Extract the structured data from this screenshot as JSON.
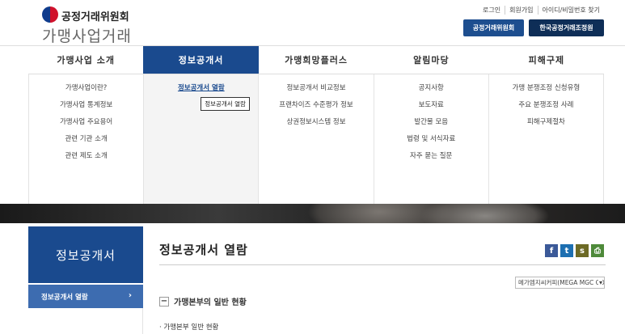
{
  "header": {
    "org_name": "공정거래위원회",
    "site_title": "가맹사업거래",
    "util_links": [
      "로그인",
      "회원가입",
      "아이디/비밀번호 찾기"
    ],
    "btn_ftc": "공정거래위원회",
    "btn_kfdm": "한국공정거래조정원"
  },
  "gnb": [
    "가맹사업 소개",
    "정보공개서",
    "가맹희망플러스",
    "알림마당",
    "피해구제"
  ],
  "mega": {
    "col0": [
      "가맹사업이란?",
      "가맹사업 통계정보",
      "가맹사업 주요용어",
      "관련 기관 소개",
      "관련 제도 소개"
    ],
    "col1": [
      "정보공개서 열람"
    ],
    "col1_tooltip": "정보공개서 열람",
    "col2": [
      "정보공개서 비교정보",
      "프랜차이즈 수준평가 정보",
      "상권정보시스템 정보"
    ],
    "col3": [
      "공지사항",
      "보도자료",
      "발간물 모음",
      "법령 및 서식자료",
      "자주 묻는 질문"
    ],
    "col4": [
      "가맹 분쟁조정 신청유형",
      "주요 분쟁조정 사례",
      "피해구제절차"
    ]
  },
  "sidebar": {
    "title": "정보공개서",
    "item": "정보공개서 열람",
    "chevron": "›"
  },
  "content": {
    "page_title": "정보공개서 열람",
    "sns": {
      "facebook": "f",
      "twitter": "t",
      "kakaostory": "s",
      "print": "⎙"
    },
    "select_value": "메가엠지씨커피(MEGA MGC COFFEE)",
    "section_toggle": "−",
    "section_title": "가맹본부의 일반 현황",
    "subsection_title": "· 가맹본부 일반 현황"
  }
}
